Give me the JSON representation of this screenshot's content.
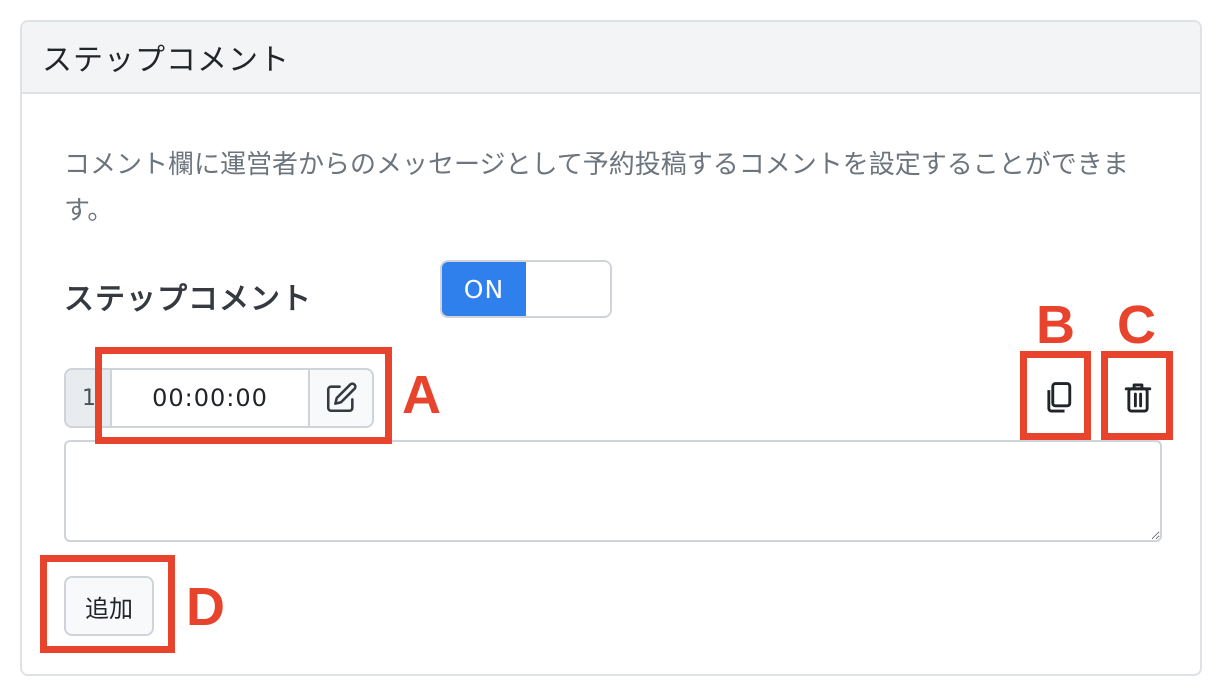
{
  "card": {
    "header_title": "ステップコメント",
    "description": "コメント欄に運営者からのメッセージとして予約投稿するコメントを設定することができます。"
  },
  "setting": {
    "label": "ステップコメント",
    "toggle_state": "ON"
  },
  "comment_row": {
    "index": "1",
    "time_value": "00:00:00",
    "edit_icon": "pencil-square-icon",
    "copy_icon": "copy-icon",
    "delete_icon": "trash-icon",
    "comment_text": ""
  },
  "actions": {
    "add_label": "追加"
  },
  "annotations": {
    "a": "A",
    "b": "B",
    "c": "C",
    "d": "D",
    "color": "#e8432d"
  },
  "colors": {
    "toggle_on": "#2f80ed",
    "header_bg": "#f3f4f6",
    "border": "#ced4da",
    "description_text": "#6c757d"
  }
}
